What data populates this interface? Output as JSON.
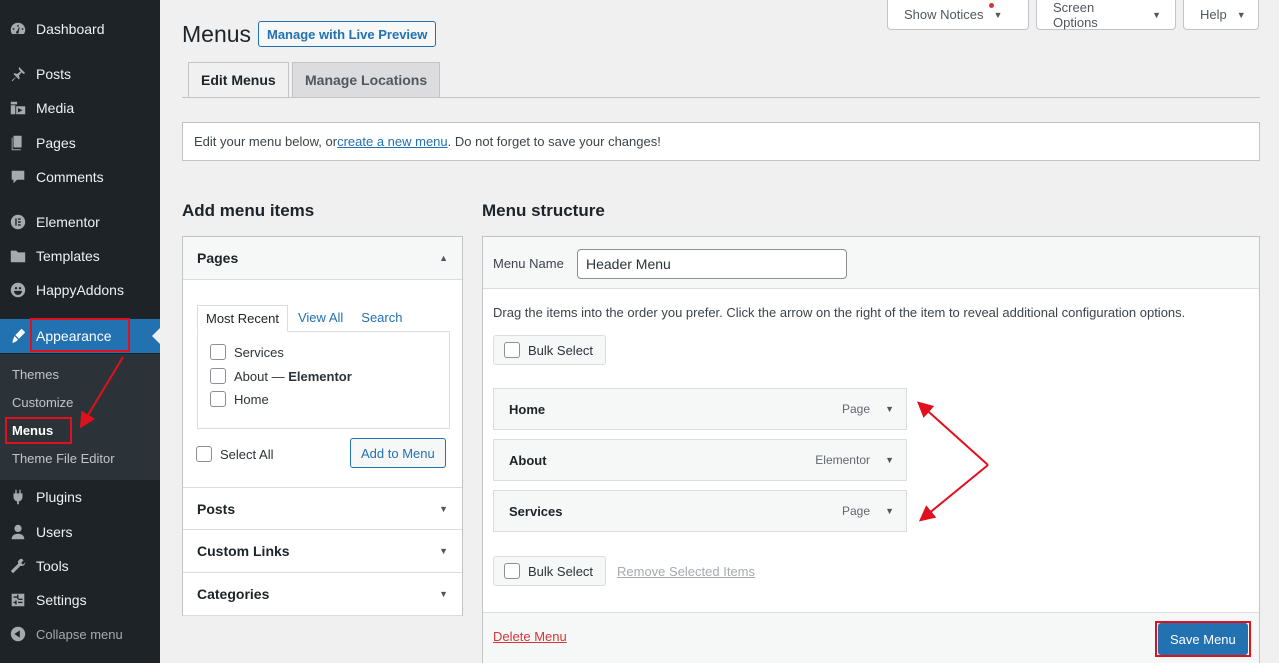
{
  "sidebar": {
    "items": [
      {
        "label": "Dashboard",
        "icon": "dashboard-icon"
      },
      {
        "label": "Posts",
        "icon": "pin-icon"
      },
      {
        "label": "Media",
        "icon": "media-icon"
      },
      {
        "label": "Pages",
        "icon": "pages-icon"
      },
      {
        "label": "Comments",
        "icon": "comment-icon"
      },
      {
        "label": "Elementor",
        "icon": "elementor-icon"
      },
      {
        "label": "Templates",
        "icon": "folder-icon"
      },
      {
        "label": "HappyAddons",
        "icon": "happy-icon"
      },
      {
        "label": "Appearance",
        "icon": "brush-icon"
      },
      {
        "label": "Plugins",
        "icon": "plug-icon"
      },
      {
        "label": "Users",
        "icon": "user-icon"
      },
      {
        "label": "Tools",
        "icon": "wrench-icon"
      },
      {
        "label": "Settings",
        "icon": "settings-icon"
      }
    ],
    "submenu": [
      "Themes",
      "Customize",
      "Menus",
      "Theme File Editor"
    ],
    "collapse_label": "Collapse menu"
  },
  "topbar": {
    "show_notices": "Show Notices",
    "screen_options": "Screen Options",
    "help": "Help"
  },
  "header": {
    "title": "Menus",
    "live_preview": "Manage with Live Preview"
  },
  "tabs": [
    "Edit Menus",
    "Manage Locations"
  ],
  "notice": {
    "before": "Edit your menu below, or ",
    "link": "create a new menu",
    "after": ". Do not forget to save your changes!"
  },
  "add_items": {
    "heading": "Add menu items",
    "sections": [
      "Pages",
      "Posts",
      "Custom Links",
      "Categories"
    ],
    "inner_tabs": [
      "Most Recent",
      "View All",
      "Search"
    ],
    "pages": [
      "Services",
      "About",
      "Home"
    ],
    "about_suffix": "Elementor",
    "about_sep": " — ",
    "select_all": "Select All",
    "add_button": "Add to Menu"
  },
  "structure": {
    "heading": "Menu structure",
    "menu_name_label": "Menu Name",
    "menu_name_value": "Header Menu",
    "instructions": "Drag the items into the order you prefer. Click the arrow on the right of the item to reveal additional configuration options.",
    "bulk_select": "Bulk Select",
    "remove_selected": "Remove Selected Items",
    "items": [
      {
        "title": "Home",
        "type": "Page"
      },
      {
        "title": "About",
        "type": "Elementor"
      },
      {
        "title": "Services",
        "type": "Page"
      }
    ],
    "delete_menu": "Delete Menu",
    "save_menu": "Save Menu"
  },
  "colors": {
    "sidebar_bg": "#1d2327",
    "accent": "#2271b1",
    "annotation": "#e0101e"
  }
}
